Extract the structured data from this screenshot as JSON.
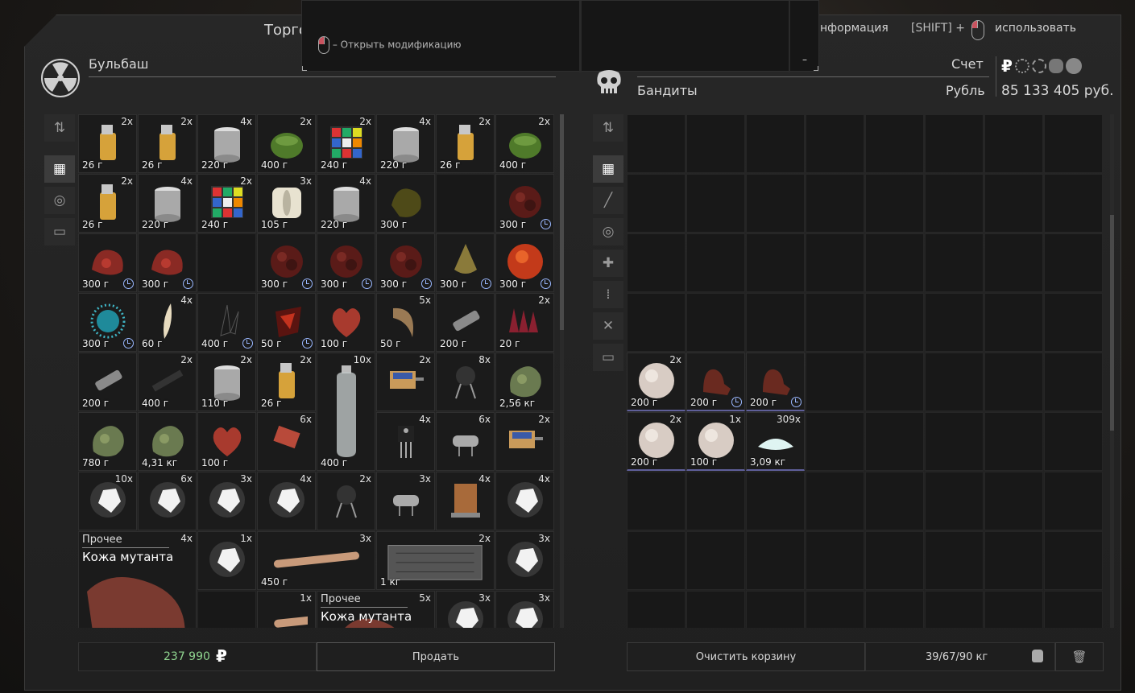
{
  "header": {
    "title": "Торго",
    "info_hint": "нформация",
    "shift_label": "[SHIFT] +",
    "use_label": "использовать"
  },
  "tooltip": {
    "mod_hint": "– Открыть модификацию",
    "minimize": "–"
  },
  "left": {
    "trader_name": "Бульбаш",
    "total": "237 990",
    "currency_symbol": "₽",
    "sell_button": "Продать",
    "special_card": {
      "category": "Прочее",
      "name": "Кожа мутанта",
      "qty": "4x"
    },
    "special_card2": {
      "category": "Прочее",
      "name": "Кожа мутанта",
      "qty": "5x"
    }
  },
  "right": {
    "faction_name": "Бандиты",
    "account_label": "Счет",
    "currency_label": "Рубль",
    "balance": "85 133 405 руб.",
    "clear_button": "Очистить корзину",
    "weight": "39/67/90 кг"
  },
  "colors": {
    "accent_green": "#8fd48f",
    "timer_blue": "#9ab8ff",
    "bg": "#202020"
  },
  "left_items": [
    {
      "r": 0,
      "c": 0,
      "qty": "2x",
      "price": "26 г",
      "icon": "lighter"
    },
    {
      "r": 0,
      "c": 1,
      "qty": "2x",
      "price": "26 г",
      "icon": "lighter"
    },
    {
      "r": 0,
      "c": 2,
      "qty": "4x",
      "price": "220 г",
      "icon": "can"
    },
    {
      "r": 0,
      "c": 3,
      "qty": "2x",
      "price": "400 г",
      "icon": "grenade"
    },
    {
      "r": 0,
      "c": 4,
      "qty": "2x",
      "price": "240 г",
      "icon": "cube"
    },
    {
      "r": 0,
      "c": 5,
      "qty": "4x",
      "price": "220 г",
      "icon": "can"
    },
    {
      "r": 0,
      "c": 6,
      "qty": "2x",
      "price": "26 г",
      "icon": "lighter"
    },
    {
      "r": 0,
      "c": 7,
      "qty": "2x",
      "price": "400 г",
      "icon": "grenade"
    },
    {
      "r": 1,
      "c": 0,
      "qty": "2x",
      "price": "26 г",
      "icon": "lighter"
    },
    {
      "r": 1,
      "c": 1,
      "qty": "4x",
      "price": "220 г",
      "icon": "can"
    },
    {
      "r": 1,
      "c": 2,
      "qty": "2x",
      "price": "240 г",
      "icon": "cube"
    },
    {
      "r": 1,
      "c": 3,
      "qty": "3x",
      "price": "105 г",
      "icon": "paper"
    },
    {
      "r": 1,
      "c": 4,
      "qty": "4x",
      "price": "220 г",
      "icon": "can"
    },
    {
      "r": 1,
      "c": 5,
      "qty": "",
      "price": "300 г",
      "icon": "organ-y"
    },
    {
      "r": 1,
      "c": 7,
      "qty": "",
      "price": "300 г",
      "icon": "organ-dark",
      "timer": true
    },
    {
      "r": 2,
      "c": 0,
      "qty": "",
      "price": "300 г",
      "icon": "flesh",
      "timer": true
    },
    {
      "r": 2,
      "c": 1,
      "qty": "",
      "price": "300 г",
      "icon": "flesh",
      "timer": true
    },
    {
      "r": 2,
      "c": 3,
      "qty": "",
      "price": "300 г",
      "icon": "organ-dark",
      "timer": true
    },
    {
      "r": 2,
      "c": 4,
      "qty": "",
      "price": "300 г",
      "icon": "organ-dark",
      "timer": true
    },
    {
      "r": 2,
      "c": 5,
      "qty": "",
      "price": "300 г",
      "icon": "organ-dark",
      "timer": true
    },
    {
      "r": 2,
      "c": 6,
      "qty": "",
      "price": "300 г",
      "icon": "claw-y",
      "timer": true
    },
    {
      "r": 2,
      "c": 7,
      "qty": "",
      "price": "300 г",
      "icon": "fire",
      "timer": true
    },
    {
      "r": 3,
      "c": 0,
      "qty": "",
      "price": "300 г",
      "icon": "spore",
      "timer": true
    },
    {
      "r": 3,
      "c": 1,
      "qty": "4x",
      "price": "60 г",
      "icon": "fang"
    },
    {
      "r": 3,
      "c": 2,
      "qty": "",
      "price": "400 г",
      "icon": "crystal",
      "timer": true
    },
    {
      "r": 3,
      "c": 3,
      "qty": "",
      "price": "50 г",
      "icon": "lava",
      "timer": true
    },
    {
      "r": 3,
      "c": 4,
      "qty": "",
      "price": "100 г",
      "icon": "heart"
    },
    {
      "r": 3,
      "c": 5,
      "qty": "5x",
      "price": "50 г",
      "icon": "claw"
    },
    {
      "r": 3,
      "c": 6,
      "qty": "",
      "price": "200 г",
      "icon": "tool"
    },
    {
      "r": 3,
      "c": 7,
      "qty": "2x",
      "price": "20 г",
      "icon": "spikes"
    },
    {
      "r": 4,
      "c": 0,
      "qty": "",
      "price": "200 г",
      "icon": "tool"
    },
    {
      "r": 4,
      "c": 1,
      "qty": "2x",
      "price": "400 г",
      "icon": "knife"
    },
    {
      "r": 4,
      "c": 2,
      "qty": "2x",
      "price": "110 г",
      "icon": "can"
    },
    {
      "r": 4,
      "c": 3,
      "qty": "2x",
      "price": "26 г",
      "icon": "lighter"
    },
    {
      "r": 4,
      "c": 5,
      "qty": "2x",
      "price": "",
      "icon": "motor"
    },
    {
      "r": 4,
      "c": 6,
      "qty": "8x",
      "price": "",
      "icon": "cap"
    },
    {
      "r": 4,
      "c": 7,
      "qty": "",
      "price": "2,56 кг",
      "icon": "moss"
    },
    {
      "r": 5,
      "c": 0,
      "qty": "",
      "price": "780 г",
      "icon": "moss"
    },
    {
      "r": 5,
      "c": 1,
      "qty": "",
      "price": "4,31 кг",
      "icon": "moss"
    },
    {
      "r": 5,
      "c": 2,
      "qty": "",
      "price": "100 г",
      "icon": "heart"
    },
    {
      "r": 5,
      "c": 3,
      "qty": "6x",
      "price": "",
      "icon": "chip"
    },
    {
      "r": 5,
      "c": 5,
      "qty": "4x",
      "price": "",
      "icon": "transistor"
    },
    {
      "r": 5,
      "c": 6,
      "qty": "6x",
      "price": "",
      "icon": "crystal-osc"
    },
    {
      "r": 5,
      "c": 7,
      "qty": "2x",
      "price": "",
      "icon": "motor"
    },
    {
      "r": 6,
      "c": 0,
      "qty": "10x",
      "price": "",
      "icon": "glow"
    },
    {
      "r": 6,
      "c": 1,
      "qty": "6x",
      "price": "",
      "icon": "glow"
    },
    {
      "r": 6,
      "c": 2,
      "qty": "3x",
      "price": "",
      "icon": "glow"
    },
    {
      "r": 6,
      "c": 3,
      "qty": "4x",
      "price": "",
      "icon": "glow"
    },
    {
      "r": 6,
      "c": 4,
      "qty": "2x",
      "price": "",
      "icon": "cap"
    },
    {
      "r": 6,
      "c": 5,
      "qty": "3x",
      "price": "",
      "icon": "crystal-osc"
    },
    {
      "r": 6,
      "c": 6,
      "qty": "4x",
      "price": "",
      "icon": "transformer"
    },
    {
      "r": 6,
      "c": 7,
      "qty": "4x",
      "price": "",
      "icon": "glow"
    },
    {
      "r": 7,
      "c": 2,
      "qty": "1x",
      "price": "",
      "icon": "glow"
    },
    {
      "r": 7,
      "c": 7,
      "qty": "3x",
      "price": "",
      "icon": "glow"
    },
    {
      "r": 8,
      "c": 6,
      "qty": "3x",
      "price": "",
      "icon": "glow"
    },
    {
      "r": 8,
      "c": 7,
      "qty": "3x",
      "price": "",
      "icon": "glow"
    }
  ],
  "left_wide": [
    {
      "r": 4,
      "c": 4,
      "w": 1,
      "h": 2,
      "qty": "10x",
      "price": "400 г",
      "icon": "bottle"
    },
    {
      "r": 7,
      "c": 3,
      "w": 2,
      "h": 1,
      "qty": "3x",
      "price": "450 г",
      "icon": "bone"
    },
    {
      "r": 7,
      "c": 5,
      "w": 2,
      "h": 1,
      "qty": "2x",
      "price": "1 кг",
      "icon": "case"
    },
    {
      "r": 8,
      "c": 3,
      "w": 1,
      "h": 1,
      "qty": "1x",
      "price": "",
      "icon": "bone"
    }
  ],
  "right_items": [
    {
      "r": 4,
      "c": 0,
      "qty": "2x",
      "price": "200 г",
      "icon": "cotton"
    },
    {
      "r": 4,
      "c": 1,
      "qty": "",
      "price": "200 г",
      "icon": "boots",
      "timer": true
    },
    {
      "r": 4,
      "c": 2,
      "qty": "",
      "price": "200 г",
      "icon": "boots",
      "timer": true
    },
    {
      "r": 5,
      "c": 0,
      "qty": "2x",
      "price": "200 г",
      "icon": "cotton"
    },
    {
      "r": 5,
      "c": 1,
      "qty": "1x",
      "price": "100 г",
      "icon": "cotton"
    },
    {
      "r": 5,
      "c": 2,
      "qty": "309x",
      "price": "3,09 кг",
      "icon": "salt"
    }
  ]
}
